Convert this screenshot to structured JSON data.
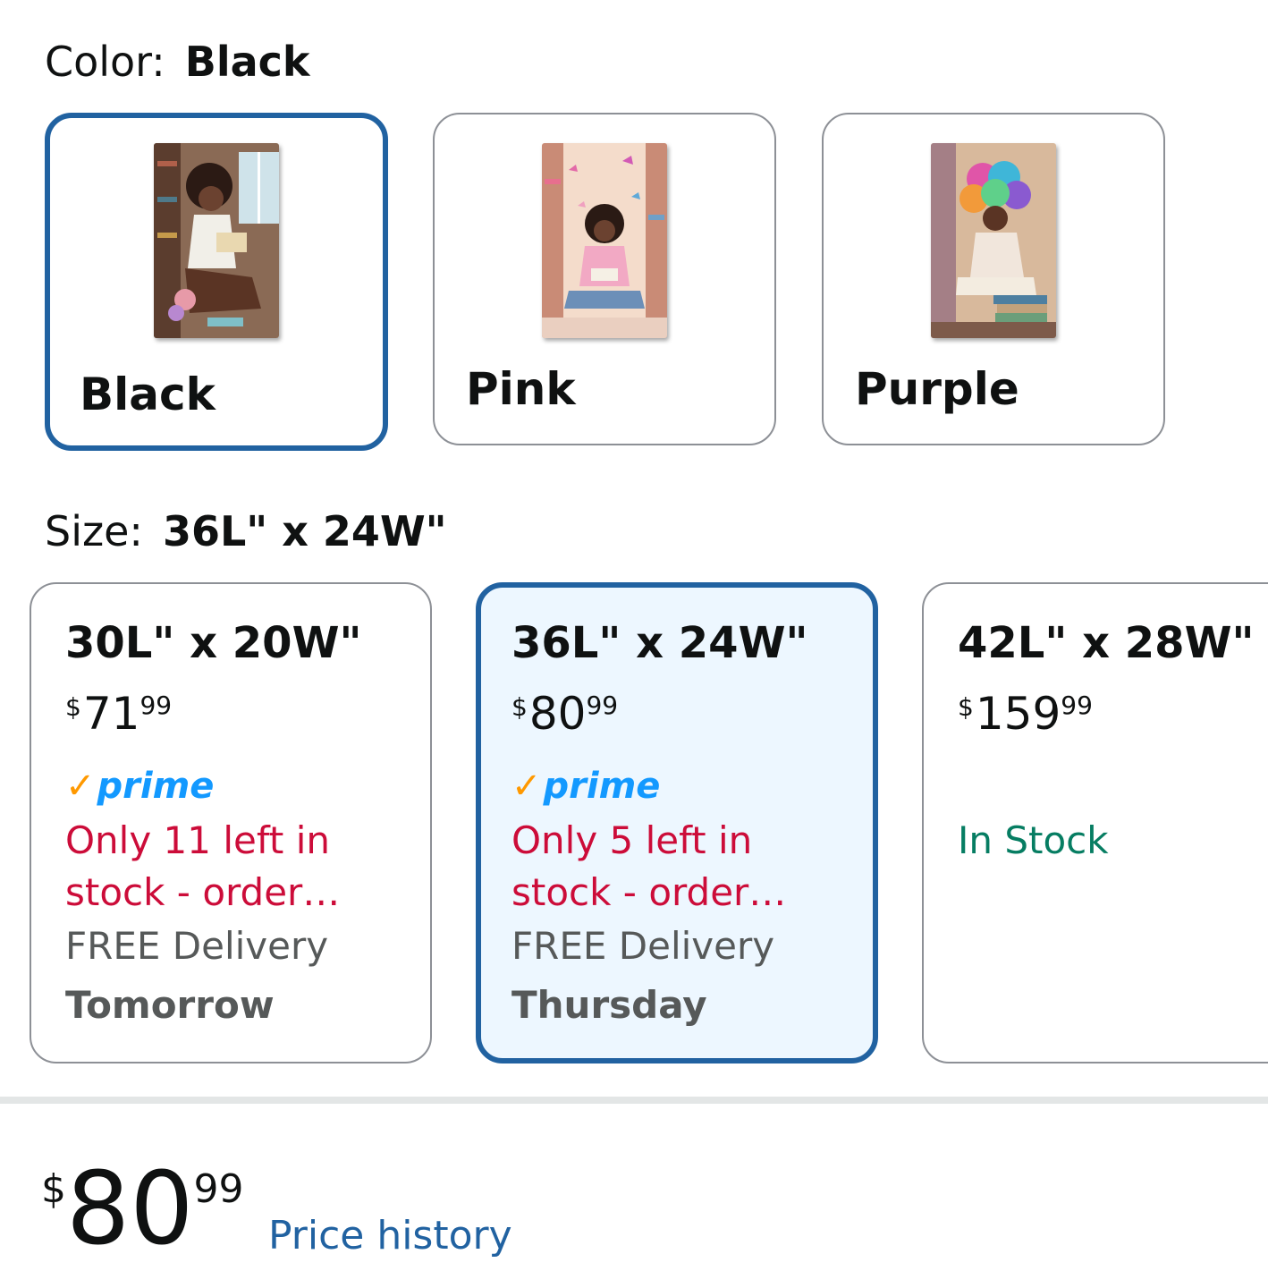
{
  "color": {
    "label": "Color:",
    "selected_value": "Black",
    "options": [
      {
        "name": "Black",
        "selected": true
      },
      {
        "name": "Pink",
        "selected": false
      },
      {
        "name": "Purple",
        "selected": false
      }
    ]
  },
  "size": {
    "label": "Size:",
    "selected_value": "36L\" x 24W\"",
    "options": [
      {
        "dimensions": "30L\" x 20W\"",
        "price_currency": "$",
        "price_whole": "71",
        "price_fraction": "99",
        "prime": "prime",
        "stock_line1": "Only 11 left in",
        "stock_line2": "stock - order…",
        "delivery": "FREE Delivery",
        "delivery_day": "Tomorrow",
        "selected": false
      },
      {
        "dimensions": "36L\" x 24W\"",
        "price_currency": "$",
        "price_whole": "80",
        "price_fraction": "99",
        "prime": "prime",
        "stock_line1": "Only 5 left in",
        "stock_line2": "stock - order…",
        "delivery": "FREE Delivery",
        "delivery_day": "Thursday",
        "selected": true
      },
      {
        "dimensions": "42L\" x 28W\"",
        "price_currency": "$",
        "price_whole": "159",
        "price_fraction": "99",
        "availability": "In Stock",
        "selected": false
      }
    ]
  },
  "buybox": {
    "price_currency": "$",
    "price_whole": "80",
    "price_fraction": "99",
    "price_history_link": "Price history"
  },
  "colors": {
    "selected_border": "#2162a1",
    "selected_bg": "#edf7ff",
    "low_stock": "#cc0c39",
    "in_stock": "#067d62",
    "prime_blue": "#1399ff",
    "prime_check": "#ff9900"
  }
}
